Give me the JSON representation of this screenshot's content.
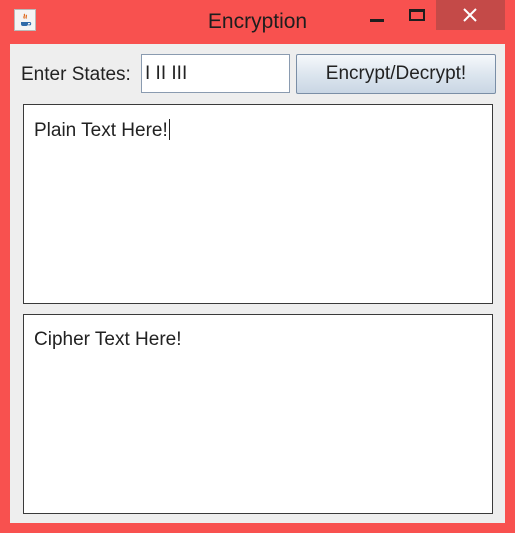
{
  "window": {
    "title": "Encryption",
    "title_color": "#1e1e1e",
    "frame_color": "#f8514f",
    "close_button_color": "#c44a48"
  },
  "titlebar": {
    "app_icon": "java-icon",
    "minimize_icon": "minimize-icon",
    "maximize_icon": "maximize-icon",
    "close_icon": "close-icon"
  },
  "form": {
    "states_label": "Enter States:",
    "states_value": "I II III",
    "action_button_label": "Encrypt/Decrypt!"
  },
  "plain_text": {
    "value": "Plain Text Here!"
  },
  "cipher_text": {
    "value": "Cipher Text Here!"
  }
}
